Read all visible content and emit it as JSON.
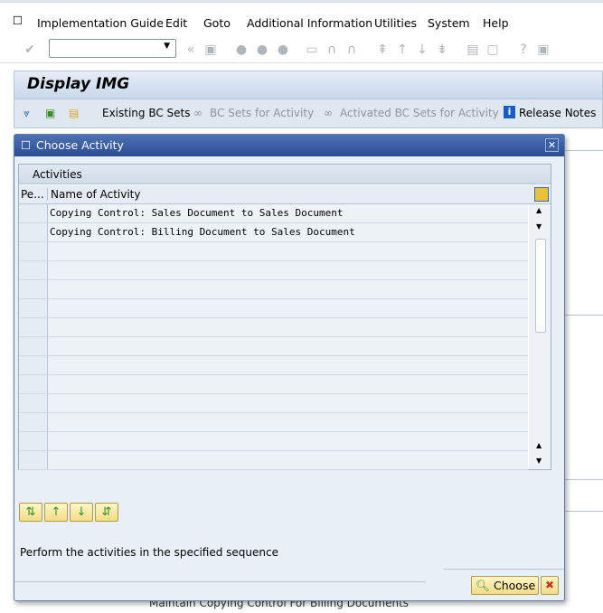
{
  "menubar": {
    "items": [
      "Implementation Guide",
      "Edit",
      "Goto",
      "Additional Information",
      "Utilities",
      "System",
      "Help"
    ]
  },
  "toolbar": {
    "command_field": ""
  },
  "app": {
    "title": "Display IMG",
    "toolbar": {
      "existing_bc_sets": "Existing BC Sets",
      "bc_sets_for_activity": "BC Sets for Activity",
      "activated_bc_sets": "Activated BC Sets for Activity",
      "release_notes": "Release Notes"
    }
  },
  "background": {
    "partial_item": "Maintain Copying Control For Billing Documents"
  },
  "dialog": {
    "title": "Choose Activity",
    "grid_title": "Activities",
    "columns": [
      "Pe...",
      "Name of Activity"
    ],
    "rows": [
      "Copying Control: Sales Document to Sales Document",
      "Copying Control: Billing Document to Sales Document",
      "",
      "",
      "",
      "",
      "",
      "",
      "",
      "",
      "",
      "",
      "",
      ""
    ],
    "message": "Perform the activities in the specified sequence",
    "choose_label": "Choose"
  },
  "colors": {
    "title_bar": "#2a4c91",
    "button": "#f3dc86",
    "cancel": "#d0341c"
  }
}
